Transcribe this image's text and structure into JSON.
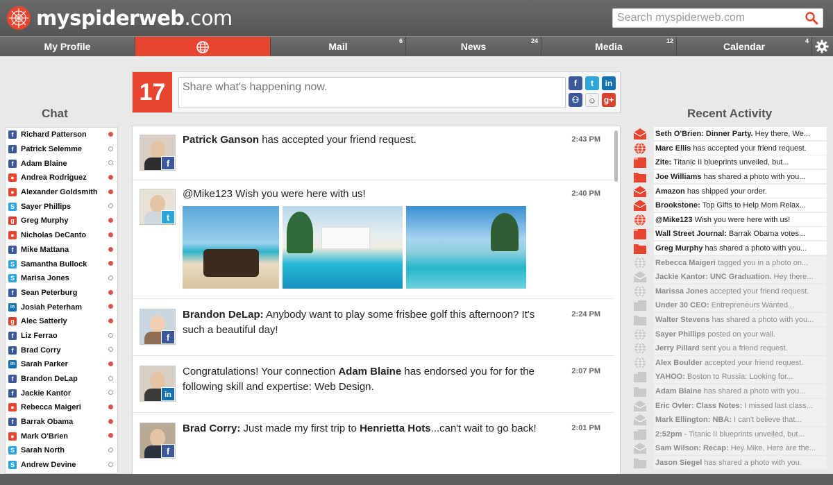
{
  "brand": {
    "logo_bold": "myspiderweb",
    "logo_rest": ".com"
  },
  "search": {
    "placeholder": "Search myspiderweb.com"
  },
  "nav": {
    "items": [
      {
        "label": "My Profile",
        "badge": ""
      },
      {
        "label": "",
        "badge": "",
        "icon": "globe-icon"
      },
      {
        "label": "Mail",
        "badge": "6"
      },
      {
        "label": "News",
        "badge": "24"
      },
      {
        "label": "Media",
        "badge": "12"
      },
      {
        "label": "Calendar",
        "badge": "4"
      }
    ]
  },
  "chat": {
    "title": "Chat",
    "contacts": [
      {
        "name": "Richard Patterson",
        "network": "facebook",
        "online": true
      },
      {
        "name": "Patrick Selemme",
        "network": "facebook",
        "online": false
      },
      {
        "name": "Adam Blaine",
        "network": "facebook",
        "online": false
      },
      {
        "name": "Andrea Rodriguez",
        "network": "other",
        "online": true
      },
      {
        "name": "Alexander Goldsmith",
        "network": "other",
        "online": true
      },
      {
        "name": "Sayer Phillips",
        "network": "skype",
        "online": false
      },
      {
        "name": "Greg Murphy",
        "network": "google",
        "online": true
      },
      {
        "name": "Nicholas DeCanto",
        "network": "other",
        "online": true
      },
      {
        "name": "Mike Mattana",
        "network": "facebook",
        "online": true
      },
      {
        "name": "Samantha Bullock",
        "network": "skype",
        "online": true
      },
      {
        "name": "Marisa Jones",
        "network": "skype",
        "online": false
      },
      {
        "name": "Sean Peterburg",
        "network": "facebook",
        "online": true
      },
      {
        "name": "Josiah Peterham",
        "network": "linkedin",
        "online": true
      },
      {
        "name": "Alec Satterly",
        "network": "google",
        "online": true
      },
      {
        "name": "Liz Ferrao",
        "network": "facebook",
        "online": false
      },
      {
        "name": "Brad Corry",
        "network": "facebook",
        "online": false
      },
      {
        "name": "Sarah Parker",
        "network": "linkedin",
        "online": true
      },
      {
        "name": "Brandon DeLap",
        "network": "facebook",
        "online": false
      },
      {
        "name": "Jackie Kantor",
        "network": "facebook",
        "online": false
      },
      {
        "name": "Rebecca Maigeri",
        "network": "other",
        "online": true
      },
      {
        "name": "Barrak Obama",
        "network": "facebook",
        "online": true
      },
      {
        "name": "Mark O'Brien",
        "network": "other",
        "online": true
      },
      {
        "name": "Sarah North",
        "network": "skype",
        "online": false
      },
      {
        "name": "Andrew Devine",
        "network": "skype",
        "online": false
      }
    ]
  },
  "compose": {
    "count": "17",
    "placeholder": "Share what's happening now."
  },
  "feed": {
    "posts": [
      {
        "author": "Patrick Ganson",
        "text": " has accepted your friend request.",
        "time": "2:43 PM",
        "network": "facebook"
      },
      {
        "author": "",
        "text": "@Mike123 Wish you were here with us!",
        "time": "2:40 PM",
        "network": "twitter"
      },
      {
        "author": "Brandon DeLap:",
        "text": " Anybody want to play some frisbee golf this afternoon? It's such a beautiful day!",
        "time": "2:24 PM",
        "network": "facebook"
      },
      {
        "author": "",
        "text_pre": "Congratulations! Your connection ",
        "highlight": "Adam Blaine",
        "text": " has endorsed you for for the following skill and expertise: Web Design.",
        "time": "2:07 PM",
        "network": "linkedin"
      },
      {
        "author": "Brad Corry:",
        "text_pre": " Just made my first trip to ",
        "highlight": "Henrietta Hots",
        "text": "...can't wait to go back!",
        "time": "2:01 PM",
        "network": "facebook"
      }
    ]
  },
  "recent": {
    "title": "Recent Activity",
    "items": [
      {
        "bold": "Seth O'Brien: Dinner Party.",
        "rest": " Hey there, We...",
        "icon": "mail",
        "old": false
      },
      {
        "bold": "Marc Ellis",
        "rest": " has accepted your friend request.",
        "icon": "globe",
        "old": false
      },
      {
        "bold": "Zite:",
        "rest": " Titanic II blueprints unveiled, but...",
        "icon": "news",
        "old": false
      },
      {
        "bold": "Joe Williams",
        "rest": " has shared a photo with you...",
        "icon": "media",
        "old": false
      },
      {
        "bold": "Amazon",
        "rest": " has shipped your order.",
        "icon": "mail",
        "old": false
      },
      {
        "bold": "Brookstone:",
        "rest": " Top Gifts to Help Mom Relax...",
        "icon": "mail",
        "old": false
      },
      {
        "bold": "@Mike123",
        "rest": " Wish you were here with us!",
        "icon": "globe",
        "old": false
      },
      {
        "bold": "Wall Street Journal:",
        "rest": " Barrak Obama votes...",
        "icon": "news",
        "old": false
      },
      {
        "bold": "Greg Murphy",
        "rest": " has shared a photo with you...",
        "icon": "media",
        "old": false
      },
      {
        "bold": "Rebecca Maigeri",
        "rest": " tagged you in a photo on...",
        "icon": "globe",
        "old": true
      },
      {
        "bold": "Jackie Kantor: UNC Graduation.",
        "rest": " Hey there...",
        "icon": "mail",
        "old": true
      },
      {
        "bold": "Marissa Jones",
        "rest": " accepted your friend request.",
        "icon": "globe",
        "old": true
      },
      {
        "bold": "Under 30 CEO:",
        "rest": " Entrepreneurs Wanted...",
        "icon": "news",
        "old": true
      },
      {
        "bold": "Walter Stevens",
        "rest": " has shared a photo with you...",
        "icon": "media",
        "old": true
      },
      {
        "bold": "Sayer Phillips",
        "rest": " posted on your wall.",
        "icon": "globe",
        "old": true
      },
      {
        "bold": "Jerry Pillard",
        "rest": " sent you a friend request.",
        "icon": "globe",
        "old": true
      },
      {
        "bold": "Alex Boulder",
        "rest": " accepted your friend request.",
        "icon": "globe",
        "old": true
      },
      {
        "bold": "YAHOO:",
        "rest": " Boston to Russia: Looking for...",
        "icon": "news",
        "old": true
      },
      {
        "bold": "Adam Blaine",
        "rest": " has shared a photo with you...",
        "icon": "media",
        "old": true
      },
      {
        "bold": "Eric Ovler: Class Notes:",
        "rest": " I missed last class...",
        "icon": "mail",
        "old": true
      },
      {
        "bold": "Mark Ellington: NBA:",
        "rest": " I can't believe that...",
        "icon": "mail",
        "old": true
      },
      {
        "bold": "2:52pm",
        "rest": " - Titanic II blueprints unveiled, but...",
        "icon": "news",
        "old": true
      },
      {
        "bold": "Sam Wilson: Recap:",
        "rest": " Hey Mike, Here are the...",
        "icon": "mail",
        "old": true
      },
      {
        "bold": "Jason Siegel",
        "rest": " has shared a photo with you.",
        "icon": "media",
        "old": true
      }
    ]
  },
  "colors": {
    "accent": "#e84530",
    "facebook": "#3b5998",
    "twitter": "#2fa6d9",
    "linkedin": "#1272b1",
    "google": "#d8432f",
    "skype": "#2aa3e0",
    "other": "#e84530"
  }
}
